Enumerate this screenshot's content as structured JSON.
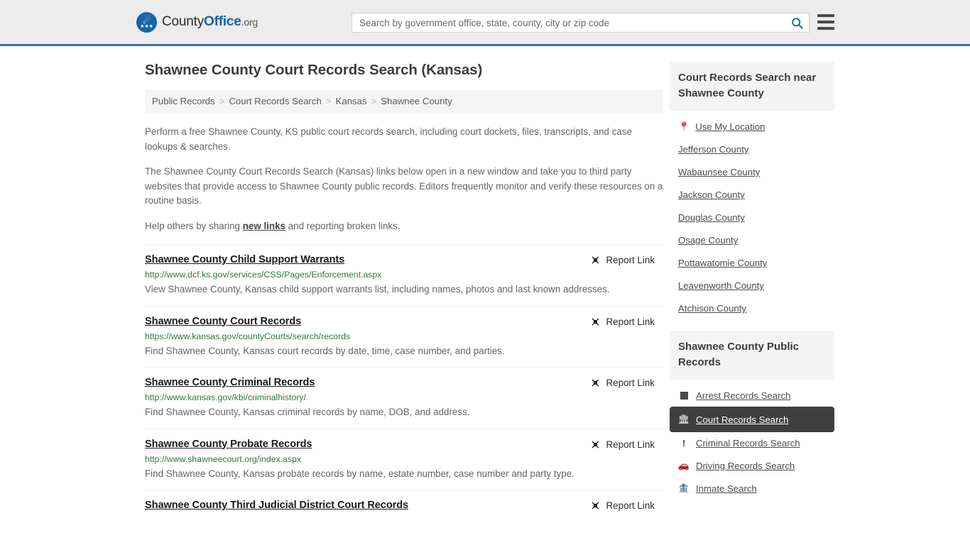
{
  "header": {
    "logo": {
      "part1": "County",
      "part2": "Office",
      "part3": ".org",
      "icon": "eagle-seal-icon"
    },
    "search": {
      "placeholder": "Search by government office, state, county, city or zip code",
      "value": "",
      "icon": "search-icon"
    },
    "menu_icon": "hamburger-menu-icon",
    "accent_color": "#3a72a8",
    "background_color": "#ececec"
  },
  "page": {
    "title": "Shawnee County Court Records Search (Kansas)"
  },
  "breadcrumb": {
    "separator": ">",
    "items": [
      {
        "label": "Public Records"
      },
      {
        "label": "Court Records Search"
      },
      {
        "label": "Kansas"
      },
      {
        "label": "Shawnee County"
      }
    ]
  },
  "intro": {
    "paragraph1": "Perform a free Shawnee County, KS public court records search, including court dockets, files, transcripts, and case lookups & searches.",
    "paragraph2": "The Shawnee County Court Records Search (Kansas) links below open in a new window and take you to third party websites that provide access to Shawnee County public records. Editors frequently monitor and verify these resources on a routine basis.",
    "paragraph3_before": "Help others by sharing ",
    "paragraph3_link": "new links",
    "paragraph3_after": " and reporting broken links."
  },
  "results": {
    "report_label": "Report Link",
    "report_icon": "broken-link-icon",
    "items": [
      {
        "title": "Shawnee County Child Support Warrants",
        "url": "http://www.dcf.ks.gov/services/CSS/Pages/Enforcement.aspx",
        "description": "View Shawnee County, Kansas child support warrants list, including names, photos and last known addresses."
      },
      {
        "title": "Shawnee County Court Records",
        "url": "https://www.kansas.gov/countyCourts/search/records",
        "description": "Find Shawnee County, Kansas court records by date, time, case number, and parties."
      },
      {
        "title": "Shawnee County Criminal Records",
        "url": "http://www.kansas.gov/kbi/criminalhistory/",
        "description": "Find Shawnee County, Kansas criminal records by name, DOB, and address."
      },
      {
        "title": "Shawnee County Probate Records",
        "url": "http://www.shawneecourt.org/index.aspx",
        "description": "Find Shawnee County, Kansas probate records by name, estate number, case number and party type."
      },
      {
        "title": "Shawnee County Third Judicial District Court Records",
        "url": "",
        "description": ""
      }
    ]
  },
  "sidebar": {
    "near_panel": {
      "title": "Court Records Search near Shawnee County",
      "use_my_location": {
        "label": "Use My Location",
        "icon": "map-pin-icon"
      },
      "counties": [
        {
          "label": "Jefferson County"
        },
        {
          "label": "Wabaunsee County"
        },
        {
          "label": "Jackson County"
        },
        {
          "label": "Douglas County"
        },
        {
          "label": "Osage County"
        },
        {
          "label": "Pottawatomie County"
        },
        {
          "label": "Leavenworth County"
        },
        {
          "label": "Atchison County"
        }
      ]
    },
    "public_records_panel": {
      "title": "Shawnee County Public Records",
      "items": [
        {
          "label": "Arrest Records Search",
          "icon": "square-badge-icon",
          "active": false
        },
        {
          "label": "Court Records Search",
          "icon": "courthouse-icon",
          "active": true
        },
        {
          "label": "Criminal Records Search",
          "icon": "exclamation-icon",
          "active": false
        },
        {
          "label": "Driving Records Search",
          "icon": "car-icon",
          "active": false
        },
        {
          "label": "Inmate Search",
          "icon": "jail-building-icon",
          "active": false
        }
      ],
      "active_background": "#3f3f3f"
    }
  }
}
